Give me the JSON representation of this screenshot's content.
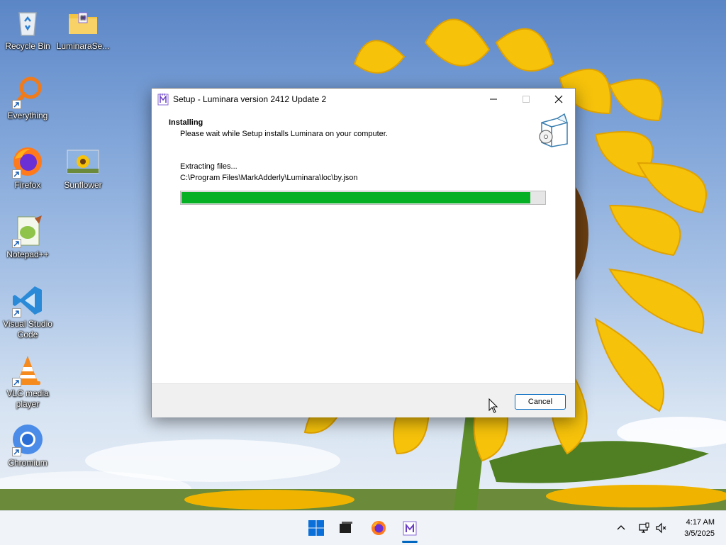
{
  "desktop": {
    "icons": [
      {
        "label": "Recycle Bin",
        "icon": "recycle-bin-icon"
      },
      {
        "label": "LuminaraSe...",
        "icon": "folder-icon"
      },
      {
        "label": "Everything",
        "icon": "everything-search-icon"
      },
      {
        "label": "Firefox",
        "icon": "firefox-icon"
      },
      {
        "label": "Sunflower",
        "icon": "image-thumbnail-icon"
      },
      {
        "label": "Notepad++",
        "icon": "notepadpp-icon"
      },
      {
        "label": "Visual Studio Code",
        "icon": "vscode-icon"
      },
      {
        "label": "VLC media player",
        "icon": "vlc-icon"
      },
      {
        "label": "Chromium",
        "icon": "chromium-icon"
      }
    ]
  },
  "window": {
    "title": "Setup - Luminara version 2412 Update 2",
    "heading": "Installing",
    "subheading": "Please wait while Setup installs Luminara on your computer.",
    "status": "Extracting files...",
    "current_file": "C:\\Program Files\\MarkAdderly\\Luminara\\loc\\by.json",
    "progress": 0.96,
    "progress_color": "#06b025",
    "cancel_label": "Cancel"
  },
  "taskbar": {
    "apps": [
      {
        "name": "start",
        "icon": "windows-start-icon"
      },
      {
        "name": "task-view",
        "icon": "task-view-icon"
      },
      {
        "name": "firefox",
        "icon": "firefox-icon"
      },
      {
        "name": "luminara-setup",
        "icon": "luminara-setup-icon",
        "active": true
      }
    ],
    "tray": [
      "chevron-up-icon",
      "network-icon",
      "volume-muted-icon"
    ],
    "time": "4:17 AM",
    "date": "3/5/2025",
    "accent": "#0067c0"
  }
}
